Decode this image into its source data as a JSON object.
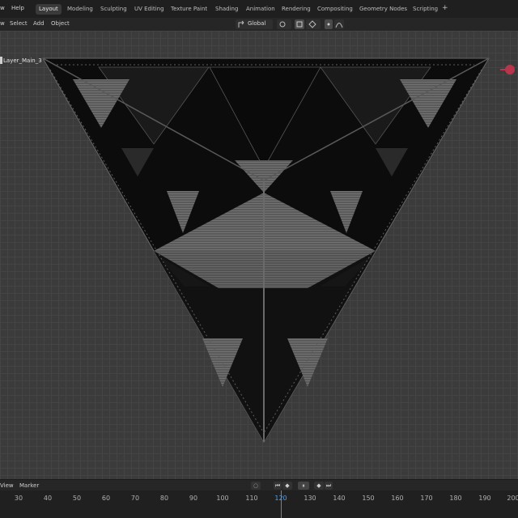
{
  "topbar": {
    "menus": [
      {
        "label": "w"
      },
      {
        "label": "Help"
      }
    ],
    "workspaces": [
      {
        "label": "Layout",
        "active": true
      },
      {
        "label": "Modeling"
      },
      {
        "label": "Sculpting"
      },
      {
        "label": "UV Editing"
      },
      {
        "label": "Texture Paint"
      },
      {
        "label": "Shading"
      },
      {
        "label": "Animation"
      },
      {
        "label": "Rendering"
      },
      {
        "label": "Compositing"
      },
      {
        "label": "Geometry Nodes"
      },
      {
        "label": "Scripting"
      }
    ],
    "add_tab": "+"
  },
  "header": {
    "view_menu": "w",
    "select_menu": "Select",
    "add_menu": "Add",
    "object_menu": "Object",
    "orientation": "Global"
  },
  "viewport": {
    "collection_label": "Layer_Main_3",
    "colors": {
      "background": "#3b3b3b",
      "grid": "#444444",
      "mesh_dark": "#0c0c0c",
      "mesh_light": "#7a7a7a",
      "gizmo_x": "#b8354b"
    }
  },
  "timeline": {
    "view_menu": "View",
    "marker_menu": "Marker",
    "current_frame": 120,
    "frame_labels": [
      "30",
      "40",
      "50",
      "60",
      "70",
      "80",
      "90",
      "100",
      "110",
      "120",
      "130",
      "140",
      "150",
      "160",
      "170",
      "180",
      "190",
      "200"
    ]
  }
}
